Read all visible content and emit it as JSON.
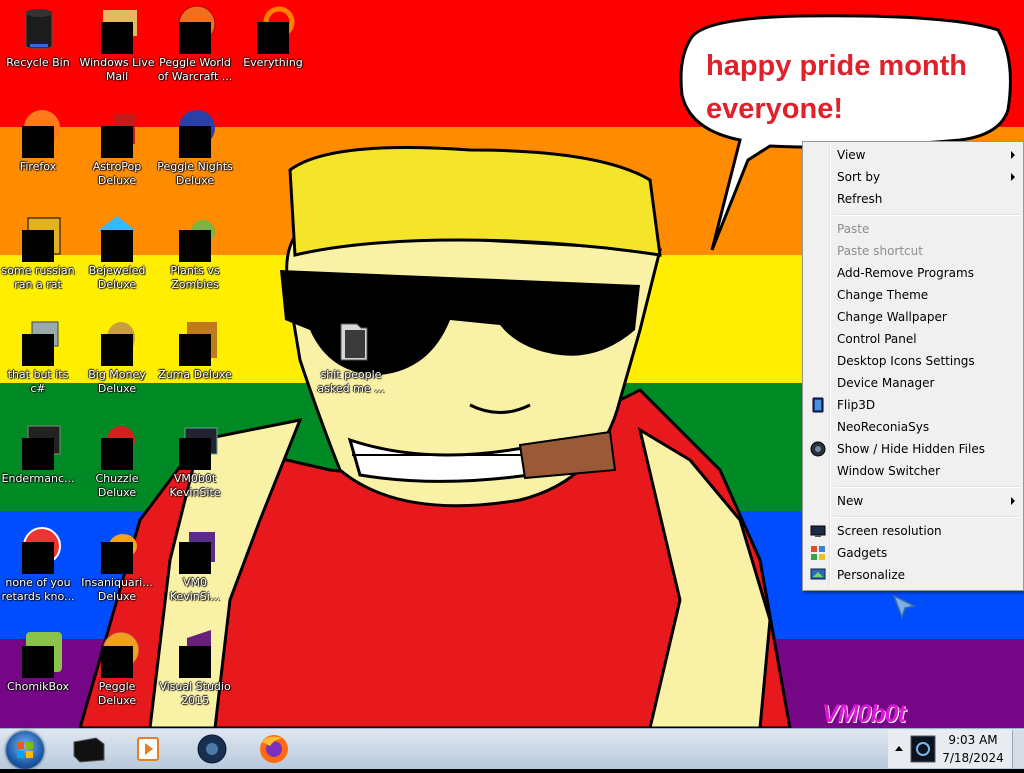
{
  "wallpaper": {
    "stripes": [
      "#ff0000",
      "#ff8c00",
      "#ffee00",
      "#008a26",
      "#004dff",
      "#750787"
    ],
    "speech_bubble": [
      "happy pride month",
      "everyone!"
    ],
    "signature": "VM0b0t"
  },
  "desktop_icons": [
    {
      "label": "Recycle Bin",
      "label2": ""
    },
    {
      "label": "Windows Live",
      "label2": "Mail"
    },
    {
      "label": "Peggle World",
      "label2": "of Warcraft ..."
    },
    {
      "label": "Everything",
      "label2": ""
    },
    {
      "label": "Firefox",
      "label2": ""
    },
    {
      "label": "AstroPop",
      "label2": "Deluxe"
    },
    {
      "label": "Peggle Nights",
      "label2": "Deluxe"
    },
    {
      "label": "some russian",
      "label2": "ran a rat"
    },
    {
      "label": "Bejeweled",
      "label2": "Deluxe"
    },
    {
      "label": "Plants vs",
      "label2": "Zombies"
    },
    {
      "label": "that but its c#",
      "label2": ""
    },
    {
      "label": "Big Money",
      "label2": "Deluxe"
    },
    {
      "label": "Zuma Deluxe",
      "label2": ""
    },
    {
      "label": "shit people",
      "label2": "asked me ..."
    },
    {
      "label": "Endermanc...",
      "label2": ""
    },
    {
      "label": "Chuzzle",
      "label2": "Deluxe"
    },
    {
      "label": "VM0b0t",
      "label2": "KevinSite"
    },
    {
      "label": "none of you",
      "label2": "retards kno..."
    },
    {
      "label": "Insaniquari...",
      "label2": "Deluxe"
    },
    {
      "label": "VM0",
      "label2": "KevinSi..."
    },
    {
      "label": "ChomikBox",
      "label2": ""
    },
    {
      "label": "Peggle Deluxe",
      "label2": ""
    },
    {
      "label": "Visual Studio",
      "label2": "2015"
    }
  ],
  "context_menu": {
    "items": [
      {
        "label": "View",
        "submenu": true
      },
      {
        "label": "Sort by",
        "submenu": true
      },
      {
        "label": "Refresh"
      },
      {
        "label": "Paste",
        "disabled": true
      },
      {
        "label": "Paste shortcut",
        "disabled": true
      },
      {
        "label": "Add-Remove Programs"
      },
      {
        "label": "Change Theme"
      },
      {
        "label": "Change Wallpaper"
      },
      {
        "label": "Control Panel"
      },
      {
        "label": "Desktop Icons Settings"
      },
      {
        "label": "Device Manager"
      },
      {
        "label": "Flip3D",
        "icon": "flip3d-icon"
      },
      {
        "label": "NeoReconiaSys"
      },
      {
        "label": "Show / Hide Hidden Files",
        "icon": "globe-icon"
      },
      {
        "label": "Window Switcher"
      },
      {
        "label": "New",
        "submenu": true
      },
      {
        "label": "Screen resolution",
        "icon": "monitor-icon"
      },
      {
        "label": "Gadgets",
        "icon": "gadgets-icon"
      },
      {
        "label": "Personalize",
        "icon": "personalize-icon"
      }
    ]
  },
  "taskbar": {
    "pinned": [
      "black-app-icon",
      "media-player-icon",
      "globe-app-icon",
      "firefox-icon"
    ],
    "clock": {
      "time": "9:03 AM",
      "date": "7/18/2024"
    }
  }
}
